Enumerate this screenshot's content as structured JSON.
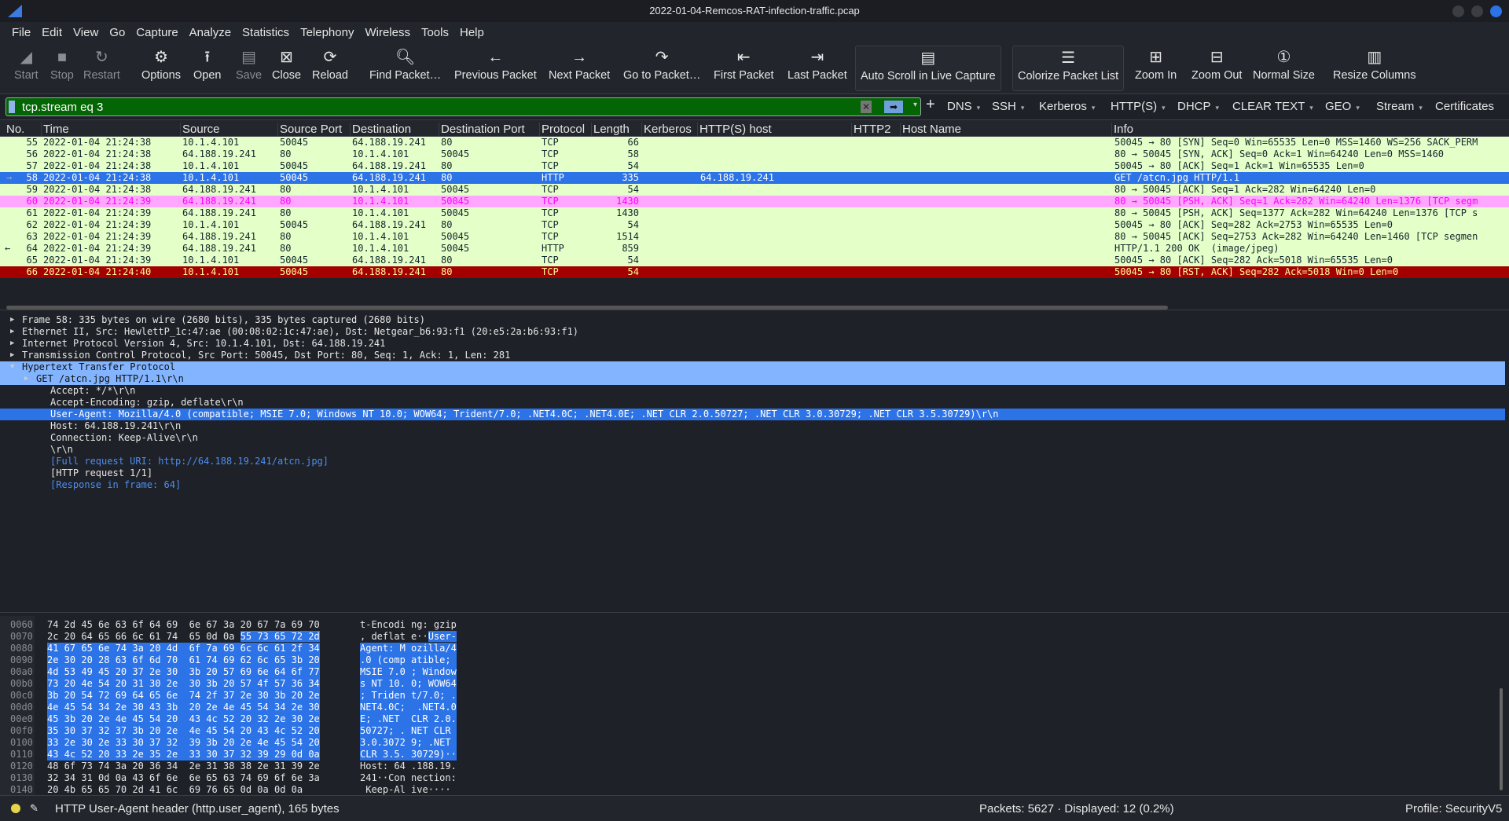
{
  "window": {
    "title": "2022-01-04-Remcos-RAT-infection-traffic.pcap"
  },
  "menu": [
    "File",
    "Edit",
    "View",
    "Go",
    "Capture",
    "Analyze",
    "Statistics",
    "Telephony",
    "Wireless",
    "Tools",
    "Help"
  ],
  "toolbar": [
    {
      "label": "Start",
      "icon": "shark-fin-icon",
      "glyph": "◢",
      "disabled": true
    },
    {
      "label": "Stop",
      "icon": "stop-icon",
      "glyph": "■",
      "disabled": true
    },
    {
      "label": "Restart",
      "icon": "restart-icon",
      "glyph": "↻",
      "disabled": true
    },
    {
      "label": "Options",
      "icon": "gear-icon",
      "glyph": "⚙"
    },
    {
      "label": "Open",
      "icon": "open-icon",
      "glyph": "⭱"
    },
    {
      "label": "Save",
      "icon": "save-icon",
      "glyph": "▤",
      "disabled": true
    },
    {
      "label": "Close",
      "icon": "close-file-icon",
      "glyph": "⊠"
    },
    {
      "label": "Reload",
      "icon": "reload-icon",
      "glyph": "⟳"
    },
    {
      "label": "Find Packet…",
      "icon": "search-icon",
      "glyph": "🔍︎"
    },
    {
      "label": "Previous Packet",
      "icon": "arrow-left-icon",
      "glyph": "←"
    },
    {
      "label": "Next Packet",
      "icon": "arrow-right-icon",
      "glyph": "→"
    },
    {
      "label": "Go to Packet…",
      "icon": "goto-icon",
      "glyph": "↷"
    },
    {
      "label": "First Packet",
      "icon": "first-packet-icon",
      "glyph": "⇤"
    },
    {
      "label": "Last Packet",
      "icon": "last-packet-icon",
      "glyph": "⇥"
    },
    {
      "label": "Auto Scroll in Live Capture",
      "icon": "autoscroll-icon",
      "glyph": "▤",
      "box": true
    },
    {
      "label": "Colorize Packet List",
      "icon": "colorize-icon",
      "glyph": "☰",
      "box": true
    },
    {
      "label": "Zoom In",
      "icon": "zoom-in-icon",
      "glyph": "⊞"
    },
    {
      "label": "Zoom Out",
      "icon": "zoom-out-icon",
      "glyph": "⊟"
    },
    {
      "label": "Normal Size",
      "icon": "normal-size-icon",
      "glyph": "①"
    },
    {
      "label": "Resize Columns",
      "icon": "resize-columns-icon",
      "glyph": "▥"
    }
  ],
  "filter": {
    "value": "tcp.stream eq 3",
    "buttons": [
      {
        "label": "DNS",
        "dd": true
      },
      {
        "label": "SSH",
        "dd": true
      },
      {
        "label": "Kerberos",
        "dd": true
      },
      {
        "label": "HTTP(S)",
        "dd": true
      },
      {
        "label": "DHCP",
        "dd": true
      },
      {
        "label": "CLEAR TEXT",
        "dd": true
      },
      {
        "label": "GEO",
        "dd": true
      },
      {
        "label": "Stream",
        "dd": true
      },
      {
        "label": "Certificates",
        "dd": false
      }
    ]
  },
  "columns": [
    "No.",
    "Time",
    "Source",
    "Source Port",
    "Destination",
    "Destination Port",
    "Protocol",
    "Length",
    "Kerberos",
    "HTTP(S) host",
    "HTTP2",
    "Host Name",
    "Info"
  ],
  "packets": [
    {
      "no": "55",
      "time": "2022-01-04 21:24:38",
      "src": "10.1.4.101",
      "sport": "50045",
      "dst": "64.188.19.241",
      "dport": "80",
      "proto": "TCP",
      "len": "66",
      "host": "",
      "info": "50045 → 80 [SYN] Seq=0 Win=65535 Len=0 MSS=1460 WS=256 SACK_PERM"
    },
    {
      "no": "56",
      "time": "2022-01-04 21:24:38",
      "src": "64.188.19.241",
      "sport": "80",
      "dst": "10.1.4.101",
      "dport": "50045",
      "proto": "TCP",
      "len": "58",
      "host": "",
      "info": "80 → 50045 [SYN, ACK] Seq=0 Ack=1 Win=64240 Len=0 MSS=1460"
    },
    {
      "no": "57",
      "time": "2022-01-04 21:24:38",
      "src": "10.1.4.101",
      "sport": "50045",
      "dst": "64.188.19.241",
      "dport": "80",
      "proto": "TCP",
      "len": "54",
      "host": "",
      "info": "50045 → 80 [ACK] Seq=1 Ack=1 Win=65535 Len=0"
    },
    {
      "no": "58",
      "time": "2022-01-04 21:24:38",
      "src": "10.1.4.101",
      "sport": "50045",
      "dst": "64.188.19.241",
      "dport": "80",
      "proto": "HTTP",
      "len": "335",
      "host": "64.188.19.241",
      "info": "GET /atcn.jpg HTTP/1.1",
      "style": "sel"
    },
    {
      "no": "59",
      "time": "2022-01-04 21:24:38",
      "src": "64.188.19.241",
      "sport": "80",
      "dst": "10.1.4.101",
      "dport": "50045",
      "proto": "TCP",
      "len": "54",
      "host": "",
      "info": "80 → 50045 [ACK] Seq=1 Ack=282 Win=64240 Len=0"
    },
    {
      "no": "60",
      "time": "2022-01-04 21:24:39",
      "src": "64.188.19.241",
      "sport": "80",
      "dst": "10.1.4.101",
      "dport": "50045",
      "proto": "TCP",
      "len": "1430",
      "host": "",
      "info": "80 → 50045 [PSH, ACK] Seq=1 Ack=282 Win=64240 Len=1376 [TCP segm",
      "style": "pink"
    },
    {
      "no": "61",
      "time": "2022-01-04 21:24:39",
      "src": "64.188.19.241",
      "sport": "80",
      "dst": "10.1.4.101",
      "dport": "50045",
      "proto": "TCP",
      "len": "1430",
      "host": "",
      "info": "80 → 50045 [PSH, ACK] Seq=1377 Ack=282 Win=64240 Len=1376 [TCP s"
    },
    {
      "no": "62",
      "time": "2022-01-04 21:24:39",
      "src": "10.1.4.101",
      "sport": "50045",
      "dst": "64.188.19.241",
      "dport": "80",
      "proto": "TCP",
      "len": "54",
      "host": "",
      "info": "50045 → 80 [ACK] Seq=282 Ack=2753 Win=65535 Len=0"
    },
    {
      "no": "63",
      "time": "2022-01-04 21:24:39",
      "src": "64.188.19.241",
      "sport": "80",
      "dst": "10.1.4.101",
      "dport": "50045",
      "proto": "TCP",
      "len": "1514",
      "host": "",
      "info": "80 → 50045 [ACK] Seq=2753 Ack=282 Win=64240 Len=1460 [TCP segmen"
    },
    {
      "no": "64",
      "time": "2022-01-04 21:24:39",
      "src": "64.188.19.241",
      "sport": "80",
      "dst": "10.1.4.101",
      "dport": "50045",
      "proto": "HTTP",
      "len": "859",
      "host": "",
      "info": "HTTP/1.1 200 OK  (image/jpeg)"
    },
    {
      "no": "65",
      "time": "2022-01-04 21:24:39",
      "src": "10.1.4.101",
      "sport": "50045",
      "dst": "64.188.19.241",
      "dport": "80",
      "proto": "TCP",
      "len": "54",
      "host": "",
      "info": "50045 → 80 [ACK] Seq=282 Ack=5018 Win=65535 Len=0"
    },
    {
      "no": "66",
      "time": "2022-01-04 21:24:40",
      "src": "10.1.4.101",
      "sport": "50045",
      "dst": "64.188.19.241",
      "dport": "80",
      "proto": "TCP",
      "len": "54",
      "host": "",
      "info": "50045 → 80 [RST, ACK] Seq=282 Ack=5018 Win=0 Len=0",
      "style": "rst"
    }
  ],
  "details": [
    {
      "text": "Frame 58: 335 bytes on wire (2680 bits), 335 bytes captured (2680 bits)",
      "indent": 0,
      "exp": "closed"
    },
    {
      "text": "Ethernet II, Src: HewlettP_1c:47:ae (00:08:02:1c:47:ae), Dst: Netgear_b6:93:f1 (20:e5:2a:b6:93:f1)",
      "indent": 0,
      "exp": "closed"
    },
    {
      "text": "Internet Protocol Version 4, Src: 10.1.4.101, Dst: 64.188.19.241",
      "indent": 0,
      "exp": "closed"
    },
    {
      "text": "Transmission Control Protocol, Src Port: 50045, Dst Port: 80, Seq: 1, Ack: 1, Len: 281",
      "indent": 0,
      "exp": "closed"
    },
    {
      "text": "Hypertext Transfer Protocol",
      "indent": 0,
      "exp": "open",
      "style": "hl"
    },
    {
      "text": "GET /atcn.jpg HTTP/1.1\\r\\n",
      "indent": 1,
      "exp": "closed",
      "style": "hl"
    },
    {
      "text": "Accept: */*\\r\\n",
      "indent": 2
    },
    {
      "text": "Accept-Encoding: gzip, deflate\\r\\n",
      "indent": 2
    },
    {
      "text": "User-Agent: Mozilla/4.0 (compatible; MSIE 7.0; Windows NT 10.0; WOW64; Trident/7.0; .NET4.0C; .NET4.0E; .NET CLR 2.0.50727; .NET CLR 3.0.30729; .NET CLR 3.5.30729)\\r\\n",
      "indent": 2,
      "style": "hl2"
    },
    {
      "text": "Host: 64.188.19.241\\r\\n",
      "indent": 2
    },
    {
      "text": "Connection: Keep-Alive\\r\\n",
      "indent": 2
    },
    {
      "text": "\\r\\n",
      "indent": 2
    },
    {
      "text": "[Full request URI: http://64.188.19.241/atcn.jpg]",
      "indent": 2,
      "style": "link"
    },
    {
      "text": "[HTTP request 1/1]",
      "indent": 2
    },
    {
      "text": "[Response in frame: 64]",
      "indent": 2,
      "style": "link"
    }
  ],
  "bytes": [
    {
      "off": "0060",
      "hex": "74 2d 45 6e 63 6f 64 69  6e 67 3a 20 67 7a 69 70",
      "ascii": "t-Encodi ng: gzip",
      "sel": "none"
    },
    {
      "off": "0070",
      "hex": "2c 20 64 65 66 6c 61 74  65 0d 0a ",
      "hexsel": "55 73 65 72 2d",
      "ascii": ", deflat e··",
      "asciisel": "User-",
      "sel": "tail"
    },
    {
      "off": "0080",
      "hex": "41 67 65 6e 74 3a 20 4d  6f 7a 69 6c 6c 61 2f 34",
      "ascii": "Agent: M ozilla/4",
      "sel": "all"
    },
    {
      "off": "0090",
      "hex": "2e 30 20 28 63 6f 6d 70  61 74 69 62 6c 65 3b 20",
      "ascii": ".0 (comp atible; ",
      "sel": "all"
    },
    {
      "off": "00a0",
      "hex": "4d 53 49 45 20 37 2e 30  3b 20 57 69 6e 64 6f 77",
      "ascii": "MSIE 7.0 ; Window",
      "sel": "all"
    },
    {
      "off": "00b0",
      "hex": "73 20 4e 54 20 31 30 2e  30 3b 20 57 4f 57 36 34",
      "ascii": "s NT 10. 0; WOW64",
      "sel": "all"
    },
    {
      "off": "00c0",
      "hex": "3b 20 54 72 69 64 65 6e  74 2f 37 2e 30 3b 20 2e",
      "ascii": "; Triden t/7.0; .",
      "sel": "all"
    },
    {
      "off": "00d0",
      "hex": "4e 45 54 34 2e 30 43 3b  20 2e 4e 45 54 34 2e 30",
      "ascii": "NET4.0C;  .NET4.0",
      "sel": "all"
    },
    {
      "off": "00e0",
      "hex": "45 3b 20 2e 4e 45 54 20  43 4c 52 20 32 2e 30 2e",
      "ascii": "E; .NET  CLR 2.0.",
      "sel": "all"
    },
    {
      "off": "00f0",
      "hex": "35 30 37 32 37 3b 20 2e  4e 45 54 20 43 4c 52 20",
      "ascii": "50727; . NET CLR ",
      "sel": "all"
    },
    {
      "off": "0100",
      "hex": "33 2e 30 2e 33 30 37 32  39 3b 20 2e 4e 45 54 20",
      "ascii": "3.0.3072 9; .NET ",
      "sel": "all"
    },
    {
      "off": "0110",
      "hex": "43 4c 52 20 33 2e 35 2e  33 30 37 32 39 29 0d 0a",
      "ascii": "CLR 3.5. 30729)··",
      "sel": "all"
    },
    {
      "off": "0120",
      "hex": "48 6f 73 74 3a 20 36 34  2e 31 38 38 2e 31 39 2e",
      "ascii": "Host: 64 .188.19.",
      "sel": "none"
    },
    {
      "off": "0130",
      "hex": "32 34 31 0d 0a 43 6f 6e  6e 65 63 74 69 6f 6e 3a",
      "ascii": "241··Con nection:",
      "sel": "none"
    },
    {
      "off": "0140",
      "hex": "20 4b 65 65 70 2d 41 6c  69 76 65 0d 0a 0d 0a",
      "ascii": " Keep-Al ive····",
      "sel": "none"
    }
  ],
  "status": {
    "field": "HTTP User-Agent header (http.user_agent), 165 bytes",
    "packets": "Packets: 5627 · Displayed: 12 (0.2%)",
    "profile": "Profile: SecurityV5"
  },
  "colors": {
    "tcp_row": "#e4ffc7",
    "selected": "#2c73e7",
    "pink_row": "#ffa6ff",
    "rst_row": "#a40000",
    "filter_valid": "#046504"
  }
}
